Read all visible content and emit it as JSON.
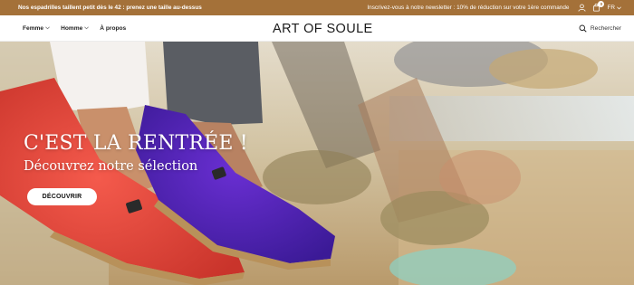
{
  "announcement": {
    "left_text": "Nos espadrilles taillent petit dès le 42 : prenez une taille au-dessus",
    "right_text": "Inscrivez-vous à notre newsletter : 10% de réduction sur votre 1ère commande",
    "cart_count": "0",
    "language": "FR",
    "background_color": "#a47139"
  },
  "header": {
    "nav": [
      {
        "label": "Femme",
        "has_dropdown": true
      },
      {
        "label": "Homme",
        "has_dropdown": true
      },
      {
        "label": "À propos",
        "has_dropdown": false
      }
    ],
    "logo": "ART OF SOULE",
    "search_label": "Rechercher"
  },
  "hero": {
    "title": "C'EST LA RENTRÉE !",
    "subtitle": "Découvrez notre sélection",
    "cta_label": "DÉCOUVRIR"
  }
}
